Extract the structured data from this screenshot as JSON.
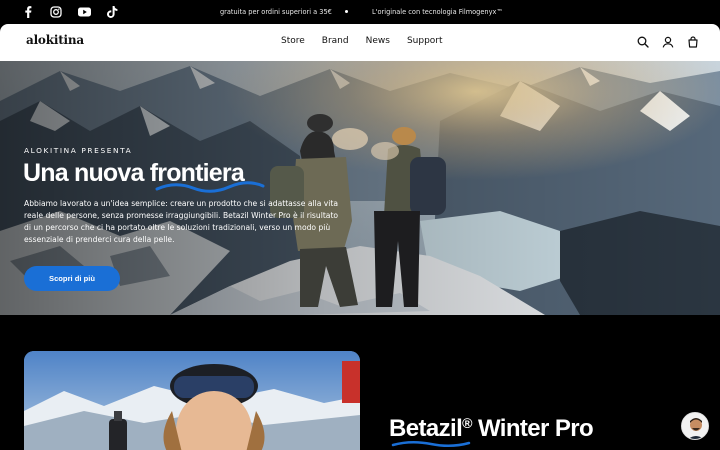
{
  "announcement": {
    "left": "gratuita per ordini superiori a 35€",
    "right": "L'originale con tecnologia Filmogenyx™"
  },
  "social": [
    "facebook-icon",
    "instagram-icon",
    "youtube-icon",
    "tiktok-icon"
  ],
  "header": {
    "logo": "alokitina",
    "nav": [
      "Store",
      "Brand",
      "News",
      "Support"
    ],
    "icons": [
      "search-icon",
      "account-icon",
      "cart-icon"
    ]
  },
  "hero": {
    "eyebrow": "ALOKITINA PRESENTA",
    "title": "Una nuova frontiera",
    "body": "Abbiamo lavorato a un'idea semplice: creare un prodotto che si adattasse alla vita reale delle persone, senza promesse irraggiungibili. Betazil Winter Pro è il risultato di un percorso che ci ha portato oltre le soluzioni tradizionali, verso un modo più essenziale di prenderci cura della pelle.",
    "cta": "Scopri di più"
  },
  "product": {
    "title_main": "Betazil",
    "title_reg": "®",
    "title_rest": " Winter Pro"
  },
  "colors": {
    "accent": "#1a6fd6",
    "background": "#000000",
    "header_bg": "#ffffff"
  }
}
